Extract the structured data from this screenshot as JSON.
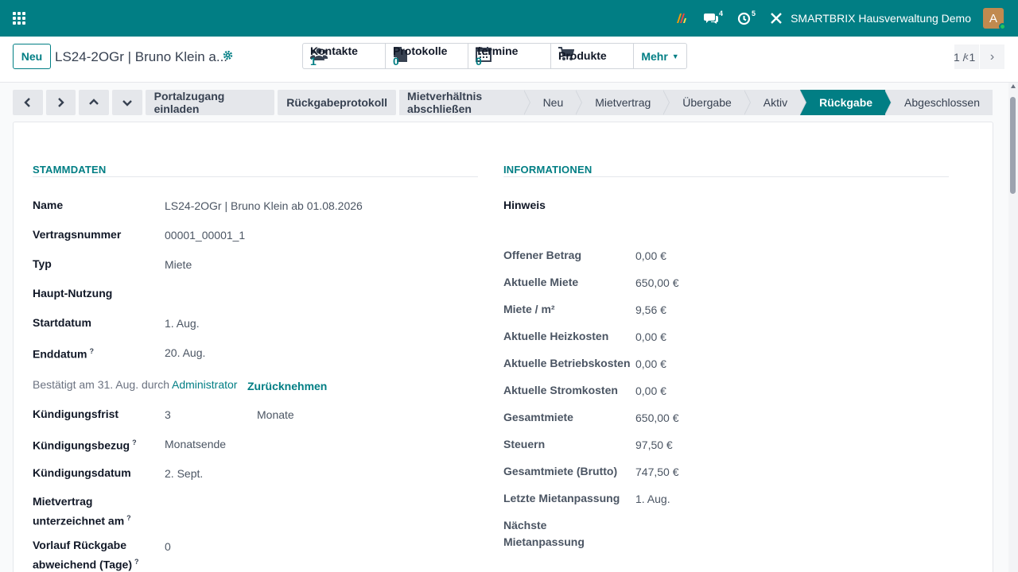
{
  "topbar": {
    "badge_chat": "4",
    "badge_activity": "5",
    "company": "SMARTBRIX Hausverwaltung Demo",
    "avatar_letter": "A"
  },
  "control": {
    "new_label": "Neu",
    "record_title": "LS24-2OGr | Bruno Klein a...",
    "smart_buttons": [
      {
        "label": "Kontakte",
        "count": "1"
      },
      {
        "label": "Protokolle",
        "count": "0"
      },
      {
        "label": "Termine",
        "count": "0"
      },
      {
        "label": "Produkte",
        "count": ""
      }
    ],
    "more_label": "Mehr",
    "pager_value": "1 / 1"
  },
  "statusbar": {
    "actions": [
      "Portalzugang einladen",
      "Rückgabeprotokoll",
      "Mietverhältnis abschließen"
    ],
    "stages": [
      "Neu",
      "Mietvertrag",
      "Übergabe",
      "Aktiv",
      "Rückgabe",
      "Abgeschlossen"
    ],
    "active_stage": "Rückgabe"
  },
  "stammdaten": {
    "title": "STAMMDATEN",
    "name_label": "Name",
    "name_value": "LS24-2OGr | Bruno Klein ab 01.08.2026",
    "vertragsnummer_label": "Vertragsnummer",
    "vertragsnummer_value": "00001_00001_1",
    "typ_label": "Typ",
    "typ_value": "Miete",
    "haupt_nutzung_label": "Haupt-Nutzung",
    "startdatum_label": "Startdatum",
    "startdatum_value": "1. Aug.",
    "enddatum_label": "Enddatum",
    "enddatum_value": "20. Aug.",
    "confirmed_text": "Bestätigt am 31. Aug. durch",
    "confirmed_user": "Administrator",
    "revoke_label": "Zurücknehmen",
    "kuendigungsfrist_label": "Kündigungsfrist",
    "kuendigungsfrist_value": "3",
    "kuendigungsfrist_unit": "Monate",
    "kuendigungsbezug_label": "Kündigungsbezug",
    "kuendigungsbezug_value": "Monatsende",
    "kuendigungsdatum_label": "Kündigungsdatum",
    "kuendigungsdatum_value": "2. Sept.",
    "mietvertrag_label_1": "Mietvertrag",
    "mietvertrag_label_2": "unterzeichnet am",
    "vorlauf_label_1": "Vorlauf Rückgabe",
    "vorlauf_label_2": "abweichend (Tage)",
    "vorlauf_value": "0",
    "help_mark": "?"
  },
  "informationen": {
    "title": "INFORMATIONEN",
    "hinweis_label": "Hinweis",
    "rows": [
      {
        "label": "Offener Betrag",
        "value": "0,00 €"
      },
      {
        "label": "Aktuelle Miete",
        "value": "650,00 €"
      },
      {
        "label": "Miete / m²",
        "value": "9,56 €"
      },
      {
        "label": "Aktuelle Heizkosten",
        "value": "0,00 €"
      },
      {
        "label": "Aktuelle Betriebskosten",
        "value": "0,00 €"
      },
      {
        "label": "Aktuelle Stromkosten",
        "value": "0,00 €"
      },
      {
        "label": "Gesamtmiete",
        "value": "650,00 €"
      },
      {
        "label": "Steuern",
        "value": "97,50 €"
      },
      {
        "label": "Gesamtmiete (Brutto)",
        "value": "747,50 €"
      },
      {
        "label": "Letzte Mietanpassung",
        "value": "1. Aug."
      }
    ],
    "naechste_label_1": "Nächste",
    "naechste_label_2": "Mietanpassung"
  },
  "colors": {
    "brand": "#017e84",
    "stage_bg": "#e5e7eb"
  }
}
